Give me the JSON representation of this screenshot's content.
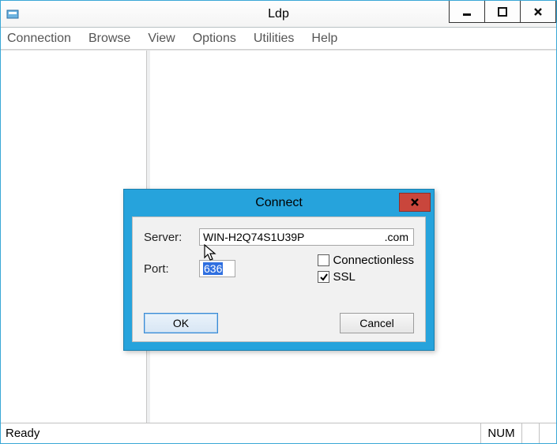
{
  "titlebar": {
    "title": "Ldp"
  },
  "menu": {
    "connection": "Connection",
    "browse": "Browse",
    "view": "View",
    "options": "Options",
    "utilities": "Utilities",
    "help": "Help"
  },
  "status": {
    "ready": "Ready",
    "num": "NUM"
  },
  "dialog": {
    "title": "Connect",
    "server_label": "Server:",
    "server_value": "WIN-H2Q74S1U39P",
    "server_suffix": ".com",
    "port_label": "Port:",
    "port_value": "636",
    "connectionless_label": "Connectionless",
    "connectionless_checked": false,
    "ssl_label": "SSL",
    "ssl_checked": true,
    "ok": "OK",
    "cancel": "Cancel"
  }
}
